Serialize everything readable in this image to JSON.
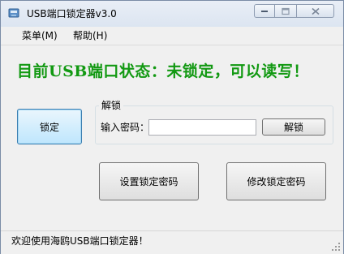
{
  "window": {
    "title": "USB端口锁定器v3.0"
  },
  "menu": {
    "items": [
      {
        "label": "菜单(M)"
      },
      {
        "label": "帮助(H)"
      }
    ]
  },
  "status": {
    "headline": "目前USB端口状态：未锁定，可以读写！",
    "headline_color": "#129912"
  },
  "buttons": {
    "lock": "锁定",
    "unlock": "解锁",
    "set_password": "设置锁定密码",
    "change_password": "修改锁定密码"
  },
  "unlock_group": {
    "legend": "解锁",
    "password_label": "输入密码：",
    "password_value": ""
  },
  "statusbar": {
    "text": "欢迎使用海鸥USB端口锁定器！"
  },
  "icons": {
    "app": "usb-app-icon",
    "minimize": "minimize-icon",
    "maximize": "maximize-icon",
    "close": "close-icon",
    "grip": "size-grip-icon"
  }
}
